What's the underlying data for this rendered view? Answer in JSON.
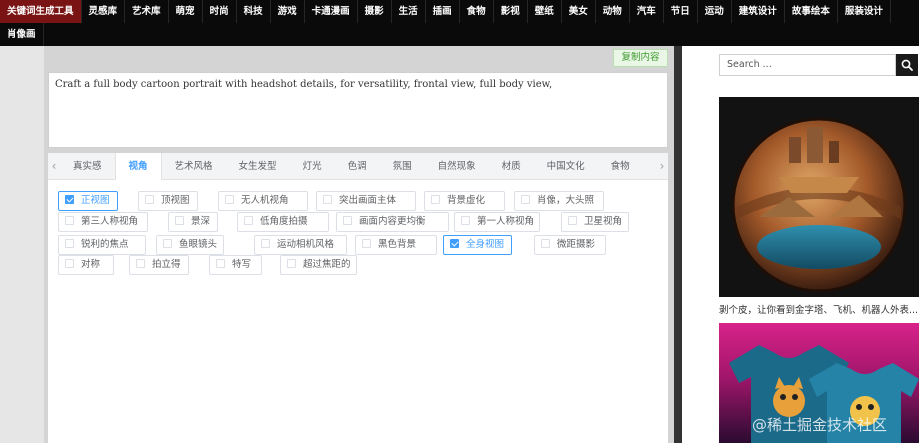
{
  "nav": {
    "row1": [
      {
        "label": "关键词生成工具",
        "active": true
      },
      {
        "label": "灵感库"
      },
      {
        "label": "艺术库"
      },
      {
        "label": "萌宠"
      },
      {
        "label": "时尚"
      },
      {
        "label": "科技"
      },
      {
        "label": "游戏"
      },
      {
        "label": "卡通漫画"
      },
      {
        "label": "摄影"
      },
      {
        "label": "生活"
      },
      {
        "label": "插画"
      },
      {
        "label": "食物"
      },
      {
        "label": "影视"
      },
      {
        "label": "壁纸"
      },
      {
        "label": "美女"
      },
      {
        "label": "动物"
      },
      {
        "label": "汽车"
      },
      {
        "label": "节日"
      },
      {
        "label": "运动"
      },
      {
        "label": "建筑设计"
      },
      {
        "label": "故事绘本"
      },
      {
        "label": "服装设计"
      }
    ],
    "row2": [
      {
        "label": "肖像画"
      }
    ]
  },
  "editor": {
    "copy_label": "复制内容",
    "prompt_text": "Craft a full body cartoon portrait with headshot details,  for versatility, frontal view, full body view,"
  },
  "tabs": {
    "left_arrow": "‹",
    "right_arrow": "›",
    "items": [
      "真实感",
      "视角",
      "艺术风格",
      "女生发型",
      "灯光",
      "色调",
      "氛围",
      "自然现象",
      "材质",
      "中国文化",
      "食物"
    ],
    "active_index": 1
  },
  "options": [
    {
      "label": "正视图",
      "checked": true
    },
    {
      "label": "顶视图",
      "checked": false
    },
    {
      "label": "无人机视角",
      "checked": false
    },
    {
      "label": "突出画面主体",
      "checked": false
    },
    {
      "label": "背景虚化",
      "checked": false
    },
    {
      "label": "肖像，大头照",
      "checked": false
    },
    {
      "label": "第三人称视角",
      "checked": false
    },
    {
      "label": "景深",
      "checked": false
    },
    {
      "label": "低角度拍摄",
      "checked": false
    },
    {
      "label": "画面内容更均衡",
      "checked": false
    },
    {
      "label": "第一人称视角",
      "checked": false
    },
    {
      "label": "卫星视角",
      "checked": false
    },
    {
      "label": "锐利的焦点",
      "checked": false
    },
    {
      "label": "鱼眼镜头",
      "checked": false
    },
    {
      "label": "运动相机风格",
      "checked": false
    },
    {
      "label": "黑色背景",
      "checked": false
    },
    {
      "label": "全身视图",
      "checked": true
    },
    {
      "label": "微距摄影",
      "checked": false
    },
    {
      "label": "对称",
      "checked": false
    },
    {
      "label": "拍立得",
      "checked": false
    },
    {
      "label": "特写",
      "checked": false
    },
    {
      "label": "超过焦距的",
      "checked": false
    }
  ],
  "sidebar": {
    "search_placeholder": "Search ...",
    "caption1": "剥个皮，让你看到金字塔、飞机、机器人外表...",
    "watermark": "@稀土掘金技术社区"
  },
  "colors": {
    "accent": "#409eff",
    "nav_bg": "#0a0a0a",
    "nav_active": "#7a1414",
    "copy_green": "#3d9a2c"
  },
  "icons": {
    "search": "search-icon",
    "tab_left": "chevron-left-icon",
    "tab_right": "chevron-right-icon"
  }
}
